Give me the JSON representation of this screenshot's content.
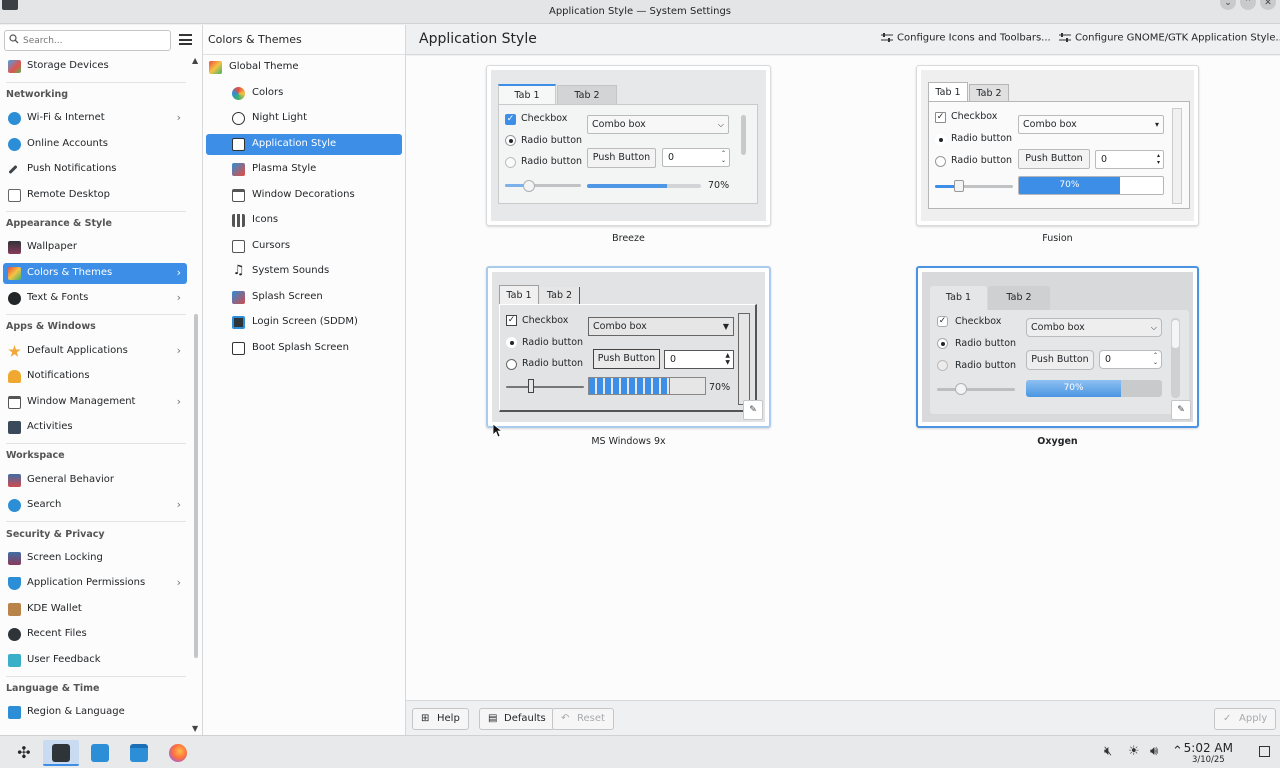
{
  "window": {
    "title": "Application Style — System Settings"
  },
  "search": {
    "placeholder": "Search..."
  },
  "nav": {
    "top_item": "Storage Devices",
    "sections": {
      "networking": "Networking",
      "appearance": "Appearance & Style",
      "apps": "Apps & Windows",
      "workspace": "Workspace",
      "security": "Security & Privacy",
      "language": "Language & Time"
    },
    "items": {
      "wifi": "Wi-Fi & Internet",
      "online": "Online Accounts",
      "push": "Push Notifications",
      "remote": "Remote Desktop",
      "wallpaper": "Wallpaper",
      "colors": "Colors & Themes",
      "text": "Text & Fonts",
      "default_apps": "Default Applications",
      "notifications": "Notifications",
      "window_mgmt": "Window Management",
      "activities": "Activities",
      "general": "General Behavior",
      "search": "Search",
      "screen_lock": "Screen Locking",
      "app_perms": "Application Permissions",
      "wallet": "KDE Wallet",
      "recent": "Recent Files",
      "feedback": "User Feedback",
      "region": "Region & Language"
    }
  },
  "subpanel": {
    "title": "Colors & Themes",
    "items": {
      "global": "Global Theme",
      "colors": "Colors",
      "night": "Night Light",
      "app_style": "Application Style",
      "plasma": "Plasma Style",
      "decorations": "Window Decorations",
      "icons": "Icons",
      "cursors": "Cursors",
      "sounds": "System Sounds",
      "splash": "Splash Screen",
      "login": "Login Screen (SDDM)",
      "boot": "Boot Splash Screen"
    }
  },
  "main": {
    "title": "Application Style",
    "configure_icons": "Configure Icons and Toolbars...",
    "configure_gtk": "Configure GNOME/GTK Application Style..."
  },
  "preview": {
    "tab1": "Tab 1",
    "tab2": "Tab 2",
    "checkbox": "Checkbox",
    "radio": "Radio button",
    "combo": "Combo box",
    "push": "Push Button",
    "spin_value": "0",
    "progress_label": "70%",
    "progress_value": 0.7
  },
  "styles": {
    "breeze": "Breeze",
    "fusion": "Fusion",
    "ms9x": "MS Windows 9x",
    "oxygen": "Oxygen"
  },
  "bottom": {
    "help": "Help",
    "defaults": "Defaults",
    "reset": "Reset",
    "apply": "Apply"
  },
  "taskbar": {
    "time": "5:02 AM",
    "date": "3/10/25"
  },
  "colors": {
    "accent": "#3d8ee6"
  }
}
